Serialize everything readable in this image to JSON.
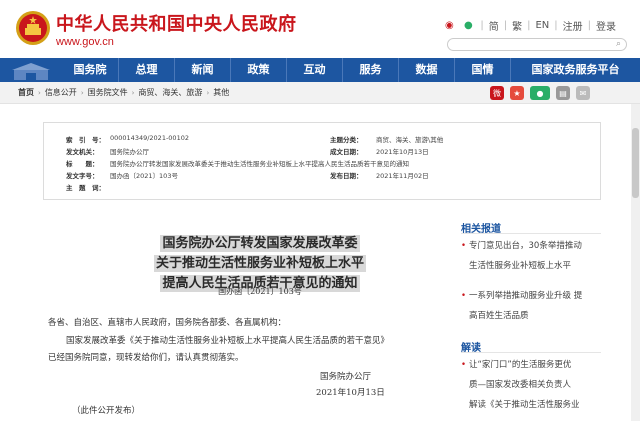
{
  "header": {
    "title": "中华人民共和国中央人民政府",
    "url": "www.gov.cn",
    "top_links": [
      "简",
      "繁",
      "EN",
      "注册",
      "登录"
    ],
    "search_placeholder": ""
  },
  "nav": {
    "items": [
      "国务院",
      "总理",
      "新闻",
      "政策",
      "互动",
      "服务",
      "数据",
      "国情",
      "国家政务服务平台"
    ]
  },
  "breadcrumb": {
    "items": [
      "首页",
      "信息公开",
      "国务院文件",
      "商贸、海关、旅游",
      "其他"
    ]
  },
  "info": {
    "index_label": "索　引　号：",
    "index_value": "000014349/2021-00102",
    "theme_label": "主题分类：",
    "theme_value": "商贸、海关、旅游\\其他",
    "issuer_label": "发文机关：",
    "issuer_value": "国务院办公厅",
    "date_label": "成文日期：",
    "date_value": "2021年10月13日",
    "title_label": "标　　题：",
    "title_value": "国务院办公厅转发国家发展改革委关于推动生活性服务业补短板上水平提高人民生活品质若干意见的通知",
    "docno_label": "发文字号：",
    "docno_value": "国办函〔2021〕103号",
    "pubdate_label": "发布日期：",
    "pubdate_value": "2021年11月02日",
    "keywords_label": "主　题　词：",
    "keywords_value": ""
  },
  "document": {
    "title_lines": [
      "国务院办公厅转发国家发展改革委",
      "关于推动生活性服务业补短板上水平",
      "提高人民生活品质若干意见的通知"
    ],
    "number": "国办函〔2021〕103号",
    "salutation": "各省、自治区、直辖市人民政府，国务院各部委、各直属机构：",
    "para1_line1": "国家发展改革委《关于推动生活性服务业补短板上水平提高人民生活品质的若干意见》",
    "para1_line2": "已经国务院同意，现转发给你们，请认真贯彻落实。",
    "signature": "国务院办公厅",
    "sign_date": "2021年10月13日",
    "note": "（此件公开发布）"
  },
  "sidebar": {
    "related_title": "相关报道",
    "related_items": [
      {
        "line1": "专门意见出台，30条举措推动",
        "line2": "生活性服务业补短板上水平"
      },
      {
        "line1": "一系列举措推动服务业升级 提",
        "line2": "高百姓生活品质"
      }
    ],
    "interpret_title": "解读",
    "interpret_items": [
      {
        "line1": "让“家门口”的生活服务更优",
        "line2": "质—国家发改委相关负责人",
        "line3": "解读《关于推动生活性服务业"
      }
    ]
  },
  "colors": {
    "brand_red": "#c9161c",
    "nav_blue": "#1d56a1"
  }
}
